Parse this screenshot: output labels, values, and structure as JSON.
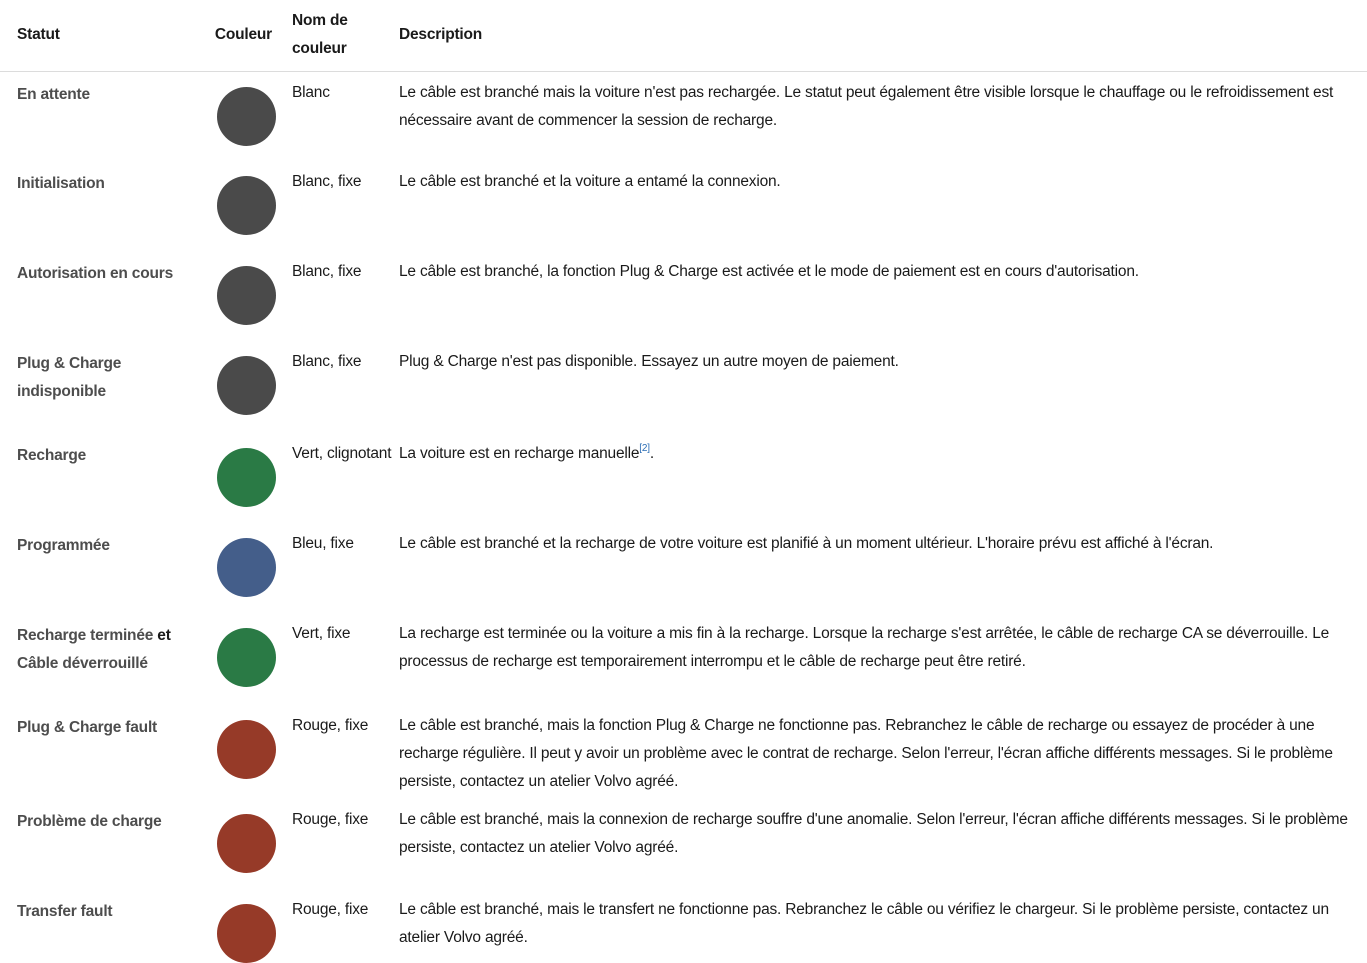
{
  "headers": {
    "status": "Statut",
    "color": "Couleur",
    "color_name": "Nom de couleur",
    "description": "Description"
  },
  "rows": [
    {
      "status": "En attente",
      "color_name": "Blanc",
      "color": "#4a4a4a",
      "description": "Le câble est branché mais la voiture n'est pas rechargée. Le statut peut également être visible lorsque le chauffage ou le refroidissement est nécessaire avant de commencer la session de recharge."
    },
    {
      "status": "Initialisation",
      "color_name": "Blanc, fixe",
      "color": "#4a4a4a",
      "description": "Le câble est branché et la voiture a entamé la connexion."
    },
    {
      "status": "Autorisation en cours",
      "color_name": "Blanc, fixe",
      "color": "#4a4a4a",
      "description": "Le câble est branché, la fonction Plug & Charge est activée et le mode de paiement est en cours d'autorisation."
    },
    {
      "status": "Plug & Charge indisponible",
      "color_name": "Blanc, fixe",
      "color": "#4a4a4a",
      "description": "Plug & Charge n'est pas disponible. Essayez un autre moyen de paiement."
    },
    {
      "status": "Recharge",
      "color_name": "Vert, clignotant",
      "color": "#2a7a45",
      "description": "La voiture est en recharge manuelle",
      "footnote": "[2]",
      "description_end": "."
    },
    {
      "status": "Programmée",
      "color_name": "Bleu, fixe",
      "color": "#445e8a",
      "description": "Le câble est branché et la recharge de votre voiture est planifié à un moment ultérieur. L'horaire prévu est affiché à l'écran."
    },
    {
      "status": "Recharge terminée",
      "status_joiner": "et",
      "status_extra": "Câble déverrouillé",
      "color_name": "Vert, fixe",
      "color": "#2a7a45",
      "description": "La recharge est terminée ou la voiture a mis fin à la recharge. Lorsque la recharge s'est arrêtée, le câble de recharge CA se déverrouille. Le processus de recharge est temporairement interrompu et le câble de recharge peut être retiré."
    },
    {
      "status": "Plug & Charge fault",
      "color_name": "Rouge, fixe",
      "color": "#963a28",
      "description": "Le câble est branché, mais la fonction Plug & Charge ne fonctionne pas. Rebranchez le câble de recharge ou essayez de procéder à une recharge régulière. Il peut y avoir un problème avec le contrat de recharge. Selon l'erreur, l'écran affiche différents messages. Si le problème persiste, contactez un atelier Volvo agréé."
    },
    {
      "status": "Problème de charge",
      "color_name": "Rouge, fixe",
      "color": "#963a28",
      "description": "Le câble est branché, mais la connexion de recharge souffre d'une anomalie. Selon l'erreur, l'écran affiche différents messages. Si le problème persiste, contactez un atelier Volvo agréé."
    },
    {
      "status": "Transfer fault",
      "color_name": "Rouge, fixe",
      "color": "#963a28",
      "description": "Le câble est branché, mais le transfert ne fonctionne pas. Rebranchez le câble ou vérifiez le chargeur. Si le problème persiste, contactez un atelier Volvo agréé."
    }
  ]
}
